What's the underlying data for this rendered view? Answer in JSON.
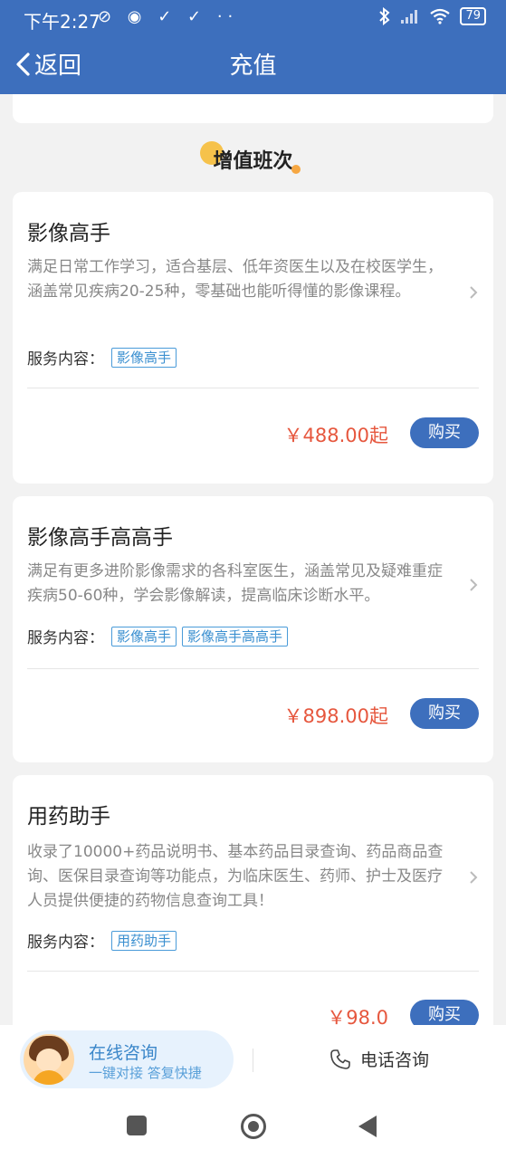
{
  "status_bar": {
    "time": "下午2:27",
    "left_icons": "⊘ ◉ ✓ ✓ ··",
    "battery": "79"
  },
  "nav": {
    "back_label": "返回",
    "title": "充值"
  },
  "section": {
    "title": "增值班次"
  },
  "products": [
    {
      "name": "影像高手",
      "desc": "满足日常工作学习，适合基层、低年资医生以及在校医学生，涵盖常见疾病20-25种，零基础也能听得懂的影像课程。",
      "service_label": "服务内容：",
      "tags": [
        "影像高手"
      ],
      "price": "￥488.00起",
      "buy_label": "购买"
    },
    {
      "name": "影像高手高高手",
      "desc": "满足有更多进阶影像需求的各科室医生，涵盖常见及疑难重症疾病50-60种，学会影像解读，提高临床诊断水平。",
      "service_label": "服务内容：",
      "tags": [
        "影像高手",
        "影像高手高高手"
      ],
      "price": "￥898.00起",
      "buy_label": "购买"
    },
    {
      "name": "用药助手",
      "desc": "收录了10000+药品说明书、基本药品目录查询、药品商品查询、医保目录查询等功能点，为临床医生、药师、护士及医疗人员提供便捷的药物信息查询工具！",
      "service_label": "服务内容：",
      "tags": [
        "用药助手"
      ],
      "price": "￥98.0",
      "buy_label": "购买"
    }
  ],
  "consult": {
    "online_title": "在线咨询",
    "online_sub": "一键对接 答复快捷",
    "phone_label": "电话咨询"
  },
  "colors": {
    "brand": "#3d6fbd",
    "price": "#e6573e",
    "tag": "#3a8fd0"
  }
}
